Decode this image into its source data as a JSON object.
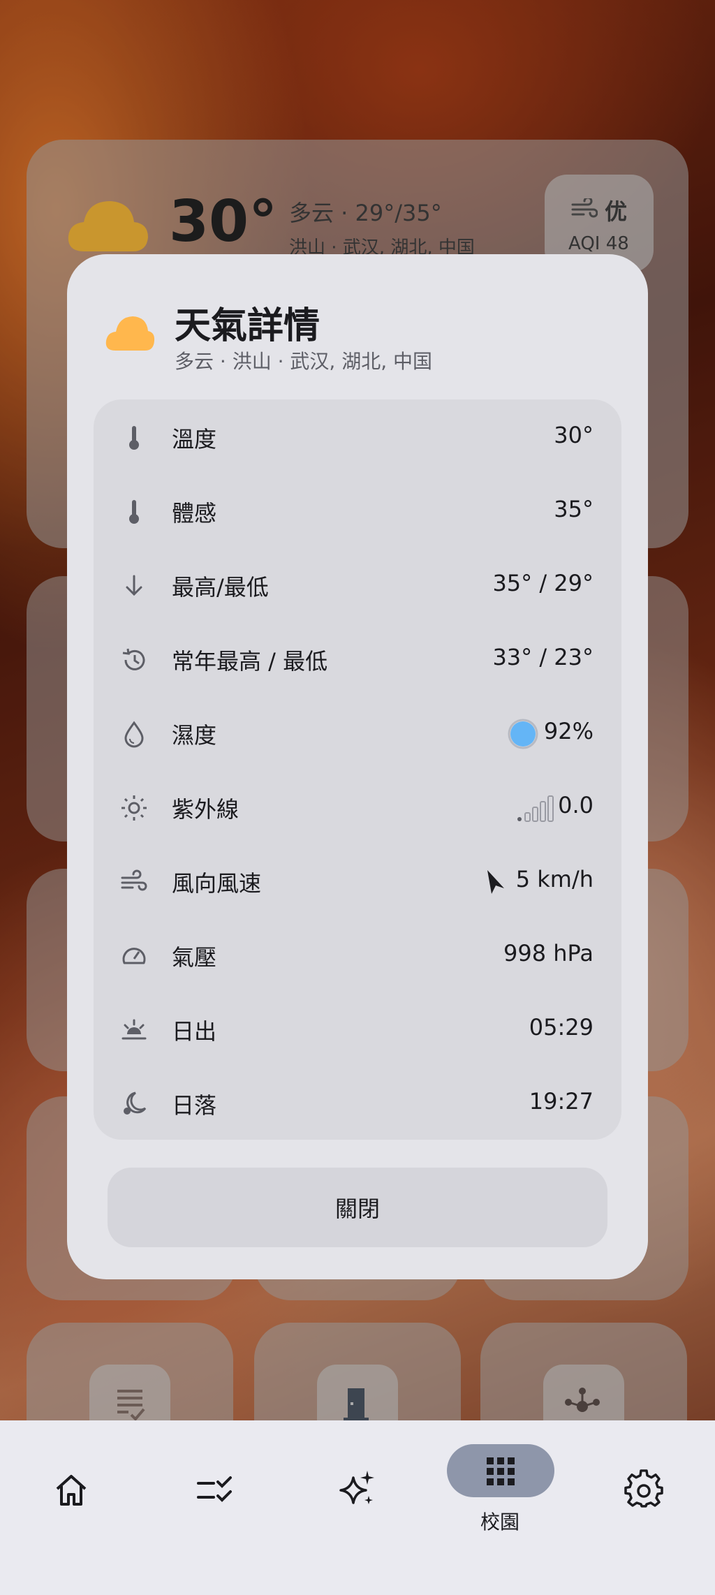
{
  "background_card": {
    "temperature": "30°",
    "condition": "多云 · 29°/35°",
    "location": "洪山 · 武汉, 湖北, 中国",
    "aqi_label": "优",
    "aqi_value": "AQI 48"
  },
  "modal": {
    "title": "天氣詳情",
    "subtitle": "多云 · 洪山 · 武汉, 湖北, 中国",
    "rows": [
      {
        "icon": "thermometer-icon",
        "label": "溫度",
        "value": "30°"
      },
      {
        "icon": "thermometer-icon",
        "label": "體感",
        "value": "35°"
      },
      {
        "icon": "arrow-down-icon",
        "label": "最高/最低",
        "value": "35° / 29°"
      },
      {
        "icon": "history-icon",
        "label": "常年最高 / 最低",
        "value": "33° / 23°"
      },
      {
        "icon": "droplet-icon",
        "label": "濕度",
        "value": "92%"
      },
      {
        "icon": "sun-icon",
        "label": "紫外線",
        "value": "0.0"
      },
      {
        "icon": "wind-icon",
        "label": "風向風速",
        "value": "5 km/h"
      },
      {
        "icon": "gauge-icon",
        "label": "氣壓",
        "value": "998 hPa"
      },
      {
        "icon": "sunrise-icon",
        "label": "日出",
        "value": "05:29"
      },
      {
        "icon": "moon-icon",
        "label": "日落",
        "value": "19:27"
      }
    ],
    "close_label": "關閉",
    "humidity_level": 0.92,
    "accent_cloud_color": "#ffb74d",
    "humidity_color": "#64b5f6"
  },
  "nav": {
    "items": [
      {
        "icon": "home-icon"
      },
      {
        "icon": "checklist-icon"
      },
      {
        "icon": "sparkle-icon"
      },
      {
        "icon": "grid-icon",
        "label": "校園",
        "active": true
      },
      {
        "icon": "gear-icon"
      }
    ]
  }
}
